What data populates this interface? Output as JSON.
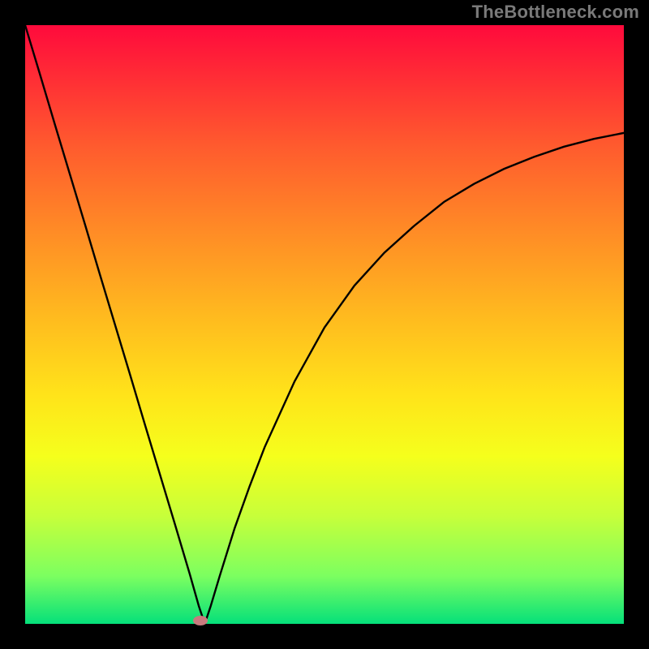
{
  "watermark": "TheBottleneck.com",
  "chart_data": {
    "type": "line",
    "title": "",
    "xlabel": "",
    "ylabel": "",
    "xlim": [
      0,
      100
    ],
    "ylim": [
      0,
      100
    ],
    "grid": false,
    "legend": false,
    "background_gradient": {
      "top_color": "#ff0a3c",
      "bottom_color": "#05e07a",
      "description": "vertical red→orange→yellow→green gradient indicating bottleneck severity (red=high, green=low)"
    },
    "series": [
      {
        "name": "bottleneck-curve",
        "color": "#000000",
        "x": [
          0.0,
          2.5,
          5.0,
          7.5,
          10.0,
          12.5,
          15.0,
          17.5,
          20.0,
          22.5,
          25.0,
          27.5,
          29.0,
          30.0,
          31.0,
          32.5,
          35.0,
          37.5,
          40.0,
          45.0,
          50.0,
          55.0,
          60.0,
          65.0,
          70.0,
          75.0,
          80.0,
          85.0,
          90.0,
          95.0,
          100.0
        ],
        "y": [
          100.0,
          91.7,
          83.3,
          75.0,
          66.7,
          58.3,
          50.0,
          41.7,
          33.3,
          25.0,
          16.7,
          8.3,
          3.0,
          0.0,
          3.0,
          8.0,
          16.0,
          23.0,
          29.5,
          40.5,
          49.5,
          56.5,
          62.0,
          66.5,
          70.5,
          73.5,
          76.0,
          78.0,
          79.7,
          81.0,
          82.0
        ]
      }
    ],
    "marker": {
      "name": "optimal-point",
      "x": 29.3,
      "y": 0.6,
      "color": "#c97a7e"
    }
  }
}
